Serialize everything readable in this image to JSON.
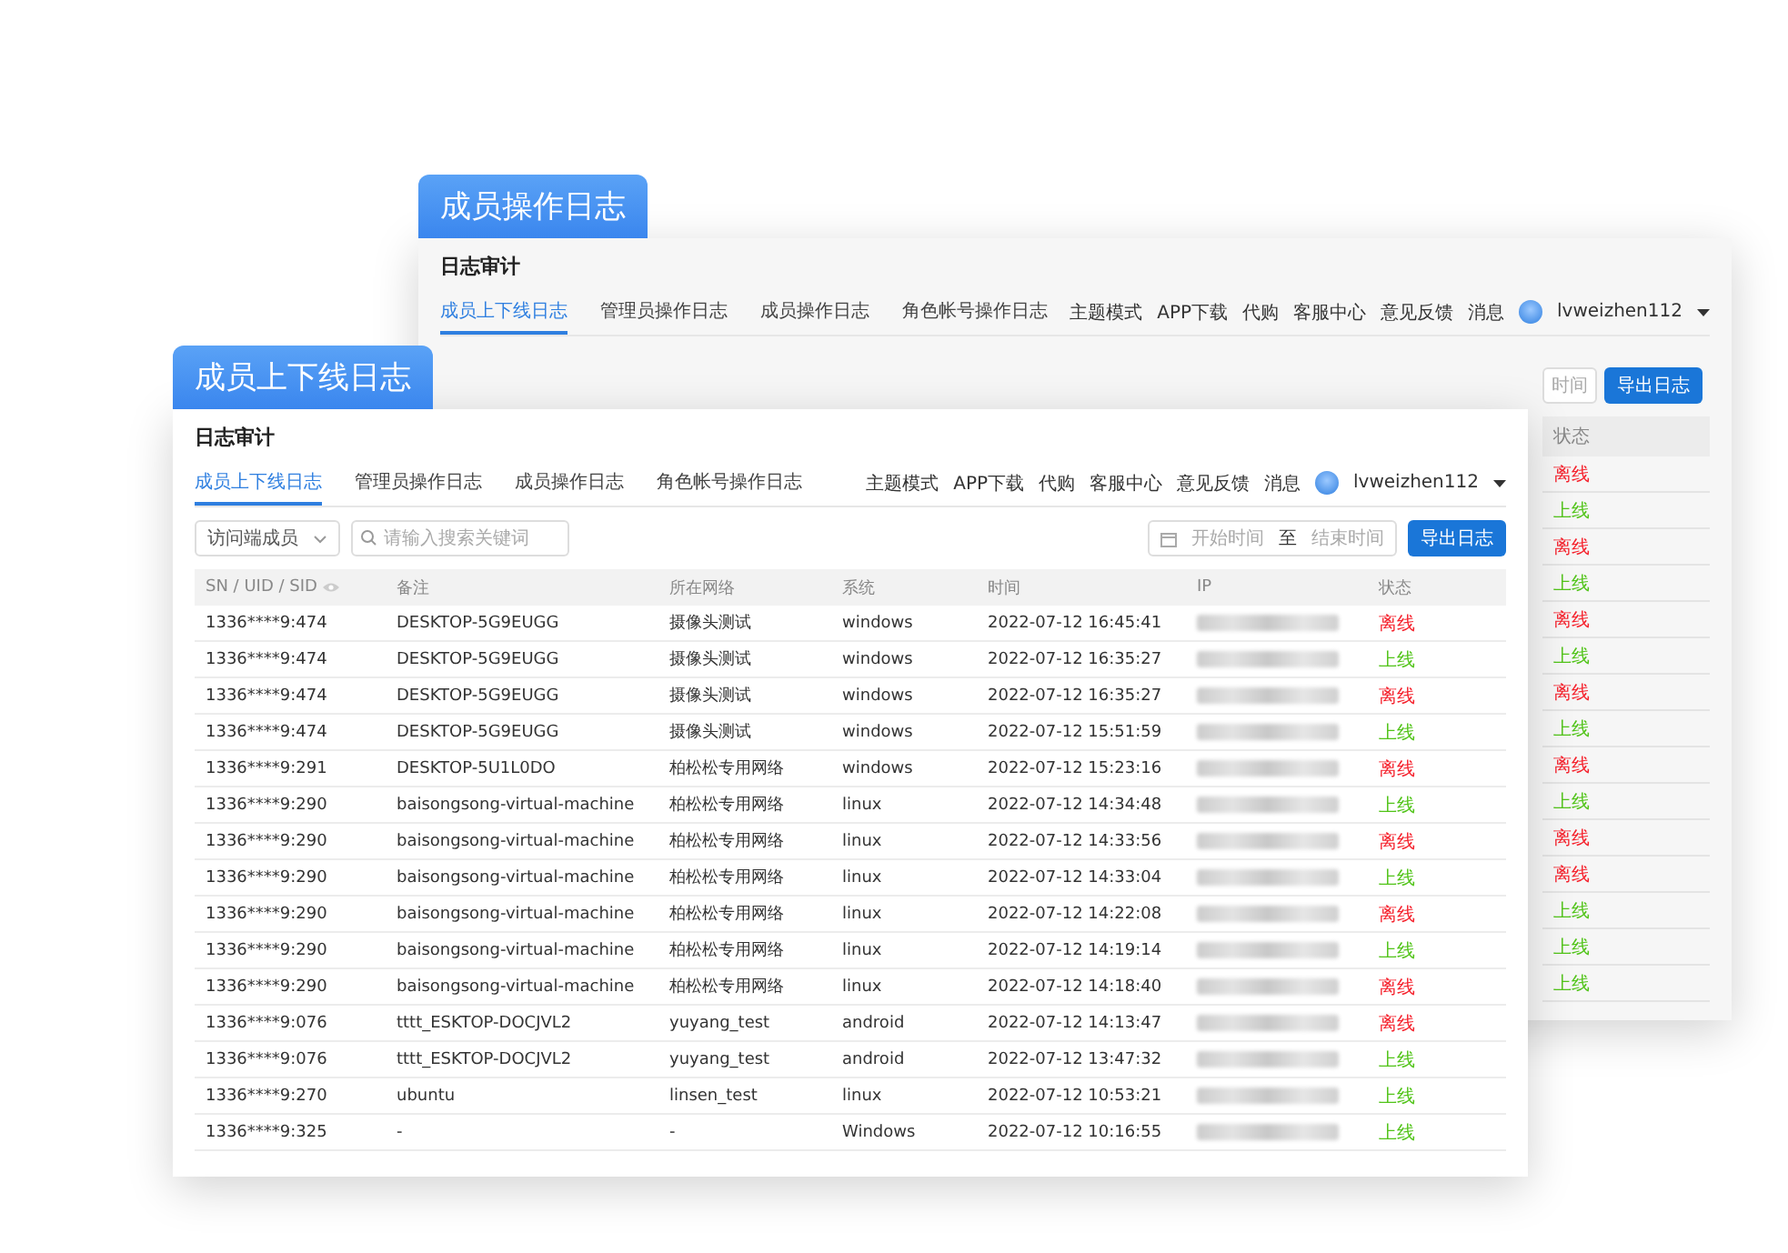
{
  "back_window": {
    "tag": "成员操作日志",
    "title": "日志审计",
    "tabs": [
      {
        "label": "成员上下线日志",
        "selected": true
      },
      {
        "label": "管理员操作日志",
        "selected": false
      },
      {
        "label": "成员操作日志",
        "selected": false
      },
      {
        "label": "角色帐号操作日志",
        "selected": false
      }
    ],
    "nav": {
      "links": [
        "主题模式",
        "APP下载",
        "代购",
        "客服中心",
        "意见反馈",
        "消息"
      ],
      "user": "lvweizhen112"
    },
    "date_end_partial": "时间",
    "export_button": "导出日志",
    "status_header": "状态",
    "statuses": [
      {
        "text": "离线",
        "online": false
      },
      {
        "text": "上线",
        "online": true
      },
      {
        "text": "离线",
        "online": false
      },
      {
        "text": "上线",
        "online": true
      },
      {
        "text": "离线",
        "online": false
      },
      {
        "text": "上线",
        "online": true
      },
      {
        "text": "离线",
        "online": false
      },
      {
        "text": "上线",
        "online": true
      },
      {
        "text": "离线",
        "online": false
      },
      {
        "text": "上线",
        "online": true
      },
      {
        "text": "离线",
        "online": false
      },
      {
        "text": "离线",
        "online": false
      },
      {
        "text": "上线",
        "online": true
      },
      {
        "text": "上线",
        "online": true
      },
      {
        "text": "上线",
        "online": true
      }
    ]
  },
  "front_window": {
    "tag": "成员上下线日志",
    "title": "日志审计",
    "tabs": [
      {
        "label": "成员上下线日志",
        "selected": true
      },
      {
        "label": "管理员操作日志",
        "selected": false
      },
      {
        "label": "成员操作日志",
        "selected": false
      },
      {
        "label": "角色帐号操作日志",
        "selected": false
      }
    ],
    "nav": {
      "links": [
        "主题模式",
        "APP下载",
        "代购",
        "客服中心",
        "意见反馈",
        "消息"
      ],
      "user": "lvweizhen112"
    },
    "filter": {
      "select": "访问端成员",
      "search_placeholder": "请输入搜索关键词"
    },
    "date_range": {
      "start_placeholder": "开始时间",
      "separator": "至",
      "end_placeholder": "结束时间"
    },
    "export_button": "导出日志",
    "table": {
      "columns": [
        "SN / UID / SID",
        "备注",
        "所在网络",
        "系统",
        "时间",
        "IP",
        "状态"
      ],
      "rows": [
        {
          "sn": "1336****9:474",
          "remark": "DESKTOP-5G9EUGG",
          "network": "摄像头测试",
          "system": "windows",
          "time": "2022-07-12 16:45:41",
          "status": {
            "text": "离线",
            "online": false
          }
        },
        {
          "sn": "1336****9:474",
          "remark": "DESKTOP-5G9EUGG",
          "network": "摄像头测试",
          "system": "windows",
          "time": "2022-07-12 16:35:27",
          "status": {
            "text": "上线",
            "online": true
          }
        },
        {
          "sn": "1336****9:474",
          "remark": "DESKTOP-5G9EUGG",
          "network": "摄像头测试",
          "system": "windows",
          "time": "2022-07-12 16:35:27",
          "status": {
            "text": "离线",
            "online": false
          }
        },
        {
          "sn": "1336****9:474",
          "remark": "DESKTOP-5G9EUGG",
          "network": "摄像头测试",
          "system": "windows",
          "time": "2022-07-12 15:51:59",
          "status": {
            "text": "上线",
            "online": true
          }
        },
        {
          "sn": "1336****9:291",
          "remark": "DESKTOP-5U1L0DO",
          "network": "柏松松专用网络",
          "system": "windows",
          "time": "2022-07-12 15:23:16",
          "status": {
            "text": "离线",
            "online": false
          }
        },
        {
          "sn": "1336****9:290",
          "remark": "baisongsong-virtual-machine",
          "network": "柏松松专用网络",
          "system": "linux",
          "time": "2022-07-12 14:34:48",
          "status": {
            "text": "上线",
            "online": true
          }
        },
        {
          "sn": "1336****9:290",
          "remark": "baisongsong-virtual-machine",
          "network": "柏松松专用网络",
          "system": "linux",
          "time": "2022-07-12 14:33:56",
          "status": {
            "text": "离线",
            "online": false
          }
        },
        {
          "sn": "1336****9:290",
          "remark": "baisongsong-virtual-machine",
          "network": "柏松松专用网络",
          "system": "linux",
          "time": "2022-07-12 14:33:04",
          "status": {
            "text": "上线",
            "online": true
          }
        },
        {
          "sn": "1336****9:290",
          "remark": "baisongsong-virtual-machine",
          "network": "柏松松专用网络",
          "system": "linux",
          "time": "2022-07-12 14:22:08",
          "status": {
            "text": "离线",
            "online": false
          }
        },
        {
          "sn": "1336****9:290",
          "remark": "baisongsong-virtual-machine",
          "network": "柏松松专用网络",
          "system": "linux",
          "time": "2022-07-12 14:19:14",
          "status": {
            "text": "上线",
            "online": true
          }
        },
        {
          "sn": "1336****9:290",
          "remark": "baisongsong-virtual-machine",
          "network": "柏松松专用网络",
          "system": "linux",
          "time": "2022-07-12 14:18:40",
          "status": {
            "text": "离线",
            "online": false
          }
        },
        {
          "sn": "1336****9:076",
          "remark": "tttt_ESKTOP-DOCJVL2",
          "network": "yuyang_test",
          "system": "android",
          "time": "2022-07-12 14:13:47",
          "status": {
            "text": "离线",
            "online": false
          }
        },
        {
          "sn": "1336****9:076",
          "remark": "tttt_ESKTOP-DOCJVL2",
          "network": "yuyang_test",
          "system": "android",
          "time": "2022-07-12 13:47:32",
          "status": {
            "text": "上线",
            "online": true
          }
        },
        {
          "sn": "1336****9:270",
          "remark": "ubuntu",
          "network": "linsen_test",
          "system": "linux",
          "time": "2022-07-12 10:53:21",
          "status": {
            "text": "上线",
            "online": true
          }
        },
        {
          "sn": "1336****9:325",
          "remark": "-",
          "network": "-",
          "system": "Windows",
          "time": "2022-07-12 10:16:55",
          "status": {
            "text": "上线",
            "online": true
          }
        }
      ]
    }
  }
}
